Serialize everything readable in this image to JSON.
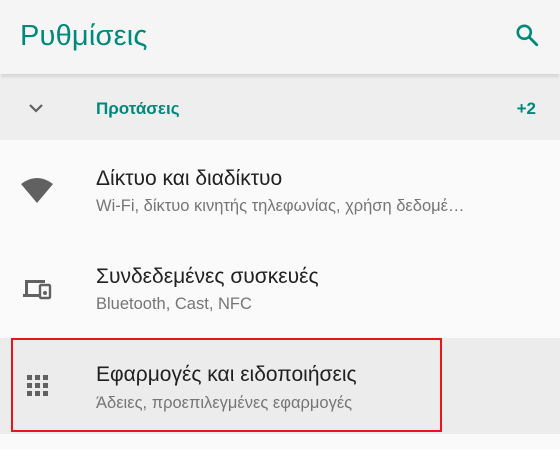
{
  "header": {
    "title": "Ρυθμίσεις",
    "search_icon": "search-icon"
  },
  "suggestions": {
    "label": "Προτάσεις",
    "count": "+2",
    "icon": "chevron-down-icon"
  },
  "items": [
    {
      "title": "Δίκτυο και διαδίκτυο",
      "subtitle": "Wi-Fi, δίκτυο κινητής τηλεφωνίας, χρήση δεδομέ…",
      "icon": "wifi-icon"
    },
    {
      "title": "Συνδεδεμένες συσκευές",
      "subtitle": "Bluetooth, Cast, NFC",
      "icon": "devices-icon"
    },
    {
      "title": "Εφαρμογές και ειδοποιήσεις",
      "subtitle": "Άδειες, προεπιλεγμένες εφαρμογές",
      "icon": "apps-grid-icon"
    }
  ],
  "colors": {
    "accent": "#00897b",
    "highlight": "#e8151b",
    "icon": "#616161"
  }
}
